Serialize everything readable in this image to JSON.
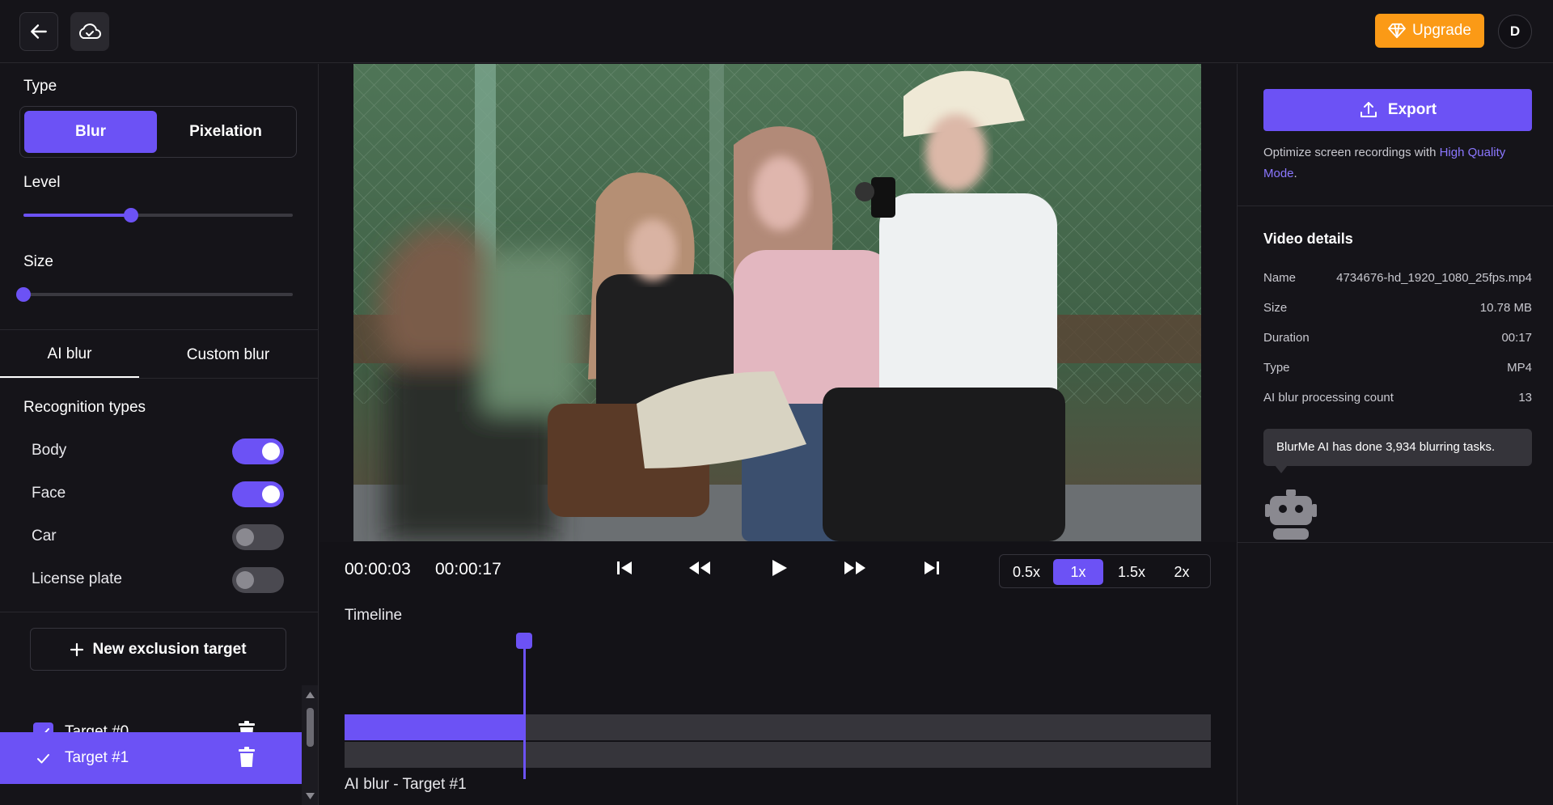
{
  "topbar": {
    "upgrade_label": "Upgrade",
    "avatar_letter": "D"
  },
  "left": {
    "type_label": "Type",
    "type_options": [
      "Blur",
      "Pixelation"
    ],
    "selected_type": "Blur",
    "level_label": "Level",
    "level_value": 0.4,
    "size_label": "Size",
    "size_value": 0.0,
    "tabs": [
      "AI blur",
      "Custom blur"
    ],
    "active_tab": "AI blur",
    "recognition_label": "Recognition types",
    "recognition": [
      {
        "label": "Body",
        "on": true
      },
      {
        "label": "Face",
        "on": true
      },
      {
        "label": "Car",
        "on": false
      },
      {
        "label": "License plate",
        "on": false
      }
    ],
    "new_target_label": "New exclusion target",
    "targets": [
      {
        "name": "Target #0",
        "checked": true,
        "selected": false
      },
      {
        "name": "Target #1",
        "checked": true,
        "selected": true
      }
    ]
  },
  "player": {
    "current_time": "00:00:03",
    "total_time": "00:00:17",
    "speeds": [
      "0.5x",
      "1x",
      "1.5x",
      "2x"
    ],
    "active_speed": "1x",
    "timeline_label": "Timeline",
    "track_label": "AI blur - Target #1",
    "progress": 0.207
  },
  "right": {
    "export_label": "Export",
    "hint_prefix": "Optimize screen recordings with",
    "hint_link": "High Quality Mode",
    "hint_suffix": ".",
    "details_title": "Video details",
    "details": [
      {
        "k": "Name",
        "v": "4734676-hd_1920_1080_25fps.mp4"
      },
      {
        "k": "Size",
        "v": "10.78 MB"
      },
      {
        "k": "Duration",
        "v": "00:17"
      },
      {
        "k": "Type",
        "v": "MP4"
      },
      {
        "k": "AI blur processing count",
        "v": "13"
      }
    ],
    "bubble_text": "BlurMe AI has done 3,934 blurring tasks."
  },
  "colors": {
    "accent": "#6c52f5",
    "upgrade": "#fb9a16",
    "background": "#151419"
  }
}
